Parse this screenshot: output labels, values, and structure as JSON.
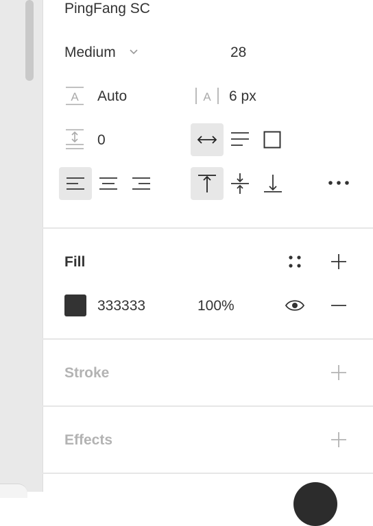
{
  "typography": {
    "font_family": "PingFang SC",
    "font_weight": "Medium",
    "font_size": "28",
    "line_height": "Auto",
    "letter_spacing": "6 px",
    "paragraph_spacing": "0"
  },
  "fill": {
    "title": "Fill",
    "color_hex": "333333",
    "opacity": "100%",
    "swatch_color": "#333333"
  },
  "stroke": {
    "title": "Stroke"
  },
  "effects": {
    "title": "Effects"
  },
  "icons": {
    "weight_dropdown": "chevron-down-icon",
    "line_height": "line-height-icon",
    "letter_spacing": "letter-spacing-icon",
    "paragraph_spacing": "paragraph-spacing-icon",
    "resize_auto_width": "auto-width-icon",
    "resize_auto_height": "auto-height-icon",
    "resize_fixed": "fixed-size-icon",
    "align_left": "align-left-icon",
    "align_center": "align-center-icon",
    "align_right": "align-right-icon",
    "align_top": "align-top-icon",
    "align_middle": "align-middle-icon",
    "align_bottom": "align-bottom-icon",
    "more": "more-options-icon",
    "styles": "styles-grid-icon",
    "add": "plus-icon",
    "remove": "minus-icon",
    "visibility": "eye-icon"
  },
  "colors": {
    "text": "#333333",
    "muted": "#b3b3b3",
    "selected_bg": "#e7e7e7",
    "sidebar_bg": "#e9e9e9"
  }
}
